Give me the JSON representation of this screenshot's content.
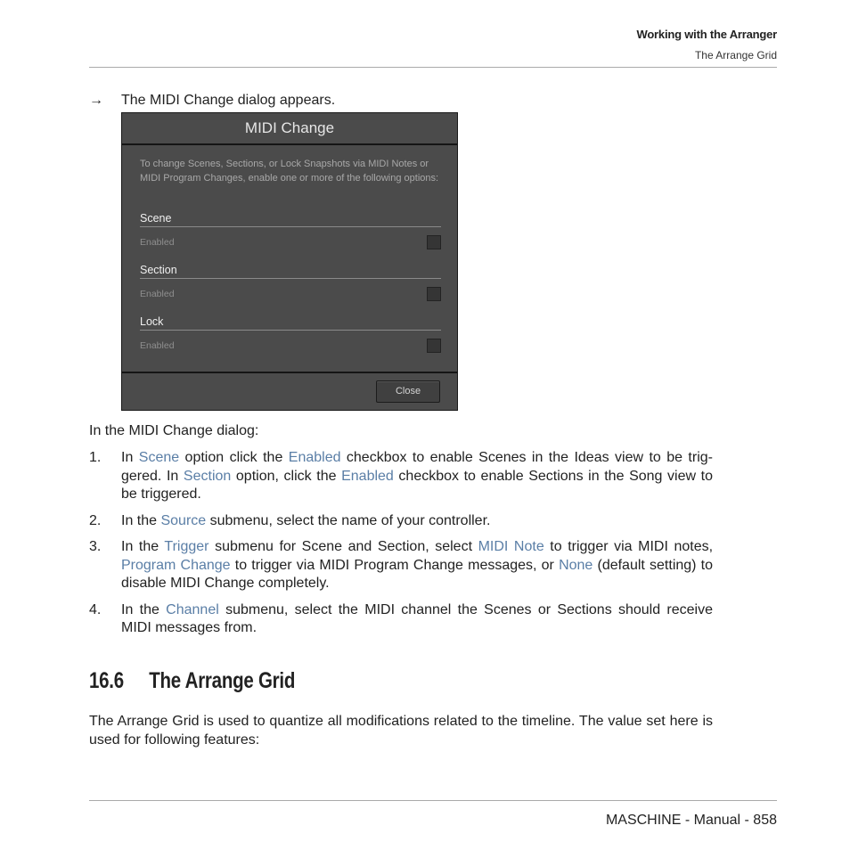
{
  "header": {
    "chapter": "Working with the Arranger",
    "section": "The Arrange Grid"
  },
  "result_line": {
    "arrow": "→",
    "text": "The MIDI Change dialog appears."
  },
  "dialog": {
    "title": "MIDI Change",
    "description": "To change Scenes, Sections, or Lock Snapshots via MIDI Notes or MIDI Program Changes, enable one or more of the following options:",
    "sections": [
      {
        "label": "Scene",
        "option": "Enabled",
        "checked": false
      },
      {
        "label": "Section",
        "option": "Enabled",
        "checked": false
      },
      {
        "label": "Lock",
        "option": "Enabled",
        "checked": false
      }
    ],
    "close_label": "Close"
  },
  "intro": "In the MIDI Change dialog:",
  "steps": [
    {
      "num": "1.",
      "parts": [
        {
          "t": "In "
        },
        {
          "t": "Scene",
          "link": true
        },
        {
          "t": " option click the "
        },
        {
          "t": "Enabled",
          "link": true
        },
        {
          "t": " checkbox to enable Scenes in the Ideas view to be trig­gered. In "
        },
        {
          "t": "Section",
          "link": true
        },
        {
          "t": " option, click the "
        },
        {
          "t": "Enabled",
          "link": true
        },
        {
          "t": " checkbox to enable Sections in the Song view to be triggered."
        }
      ]
    },
    {
      "num": "2.",
      "parts": [
        {
          "t": "In the "
        },
        {
          "t": "Source",
          "link": true
        },
        {
          "t": " submenu, select the name of your controller."
        }
      ]
    },
    {
      "num": "3.",
      "parts": [
        {
          "t": "In the "
        },
        {
          "t": "Trigger",
          "link": true
        },
        {
          "t": " submenu for Scene and Section, select "
        },
        {
          "t": "MIDI Note",
          "link": true
        },
        {
          "t": " to trigger via MIDI notes, "
        },
        {
          "t": "Program Change",
          "link": true
        },
        {
          "t": " to trigger via MIDI Program Change messages, or "
        },
        {
          "t": "None",
          "link": true
        },
        {
          "t": " (default setting) to disable MIDI Change completely."
        }
      ]
    },
    {
      "num": "4.",
      "parts": [
        {
          "t": "In the "
        },
        {
          "t": "Channel",
          "link": true
        },
        {
          "t": " submenu, select the MIDI channel the Scenes or Sections should receive MIDI messages from."
        }
      ]
    }
  ],
  "heading": {
    "number": "16.6",
    "title": "The Arrange Grid"
  },
  "paragraph": "The Arrange Grid is used to quantize all modifications related to the timeline. The value set here is used for following features:",
  "footer": "MASCHINE - Manual - 858",
  "colors": {
    "link": "#5a7ea6",
    "dialog_bg": "#4b4b4b"
  }
}
